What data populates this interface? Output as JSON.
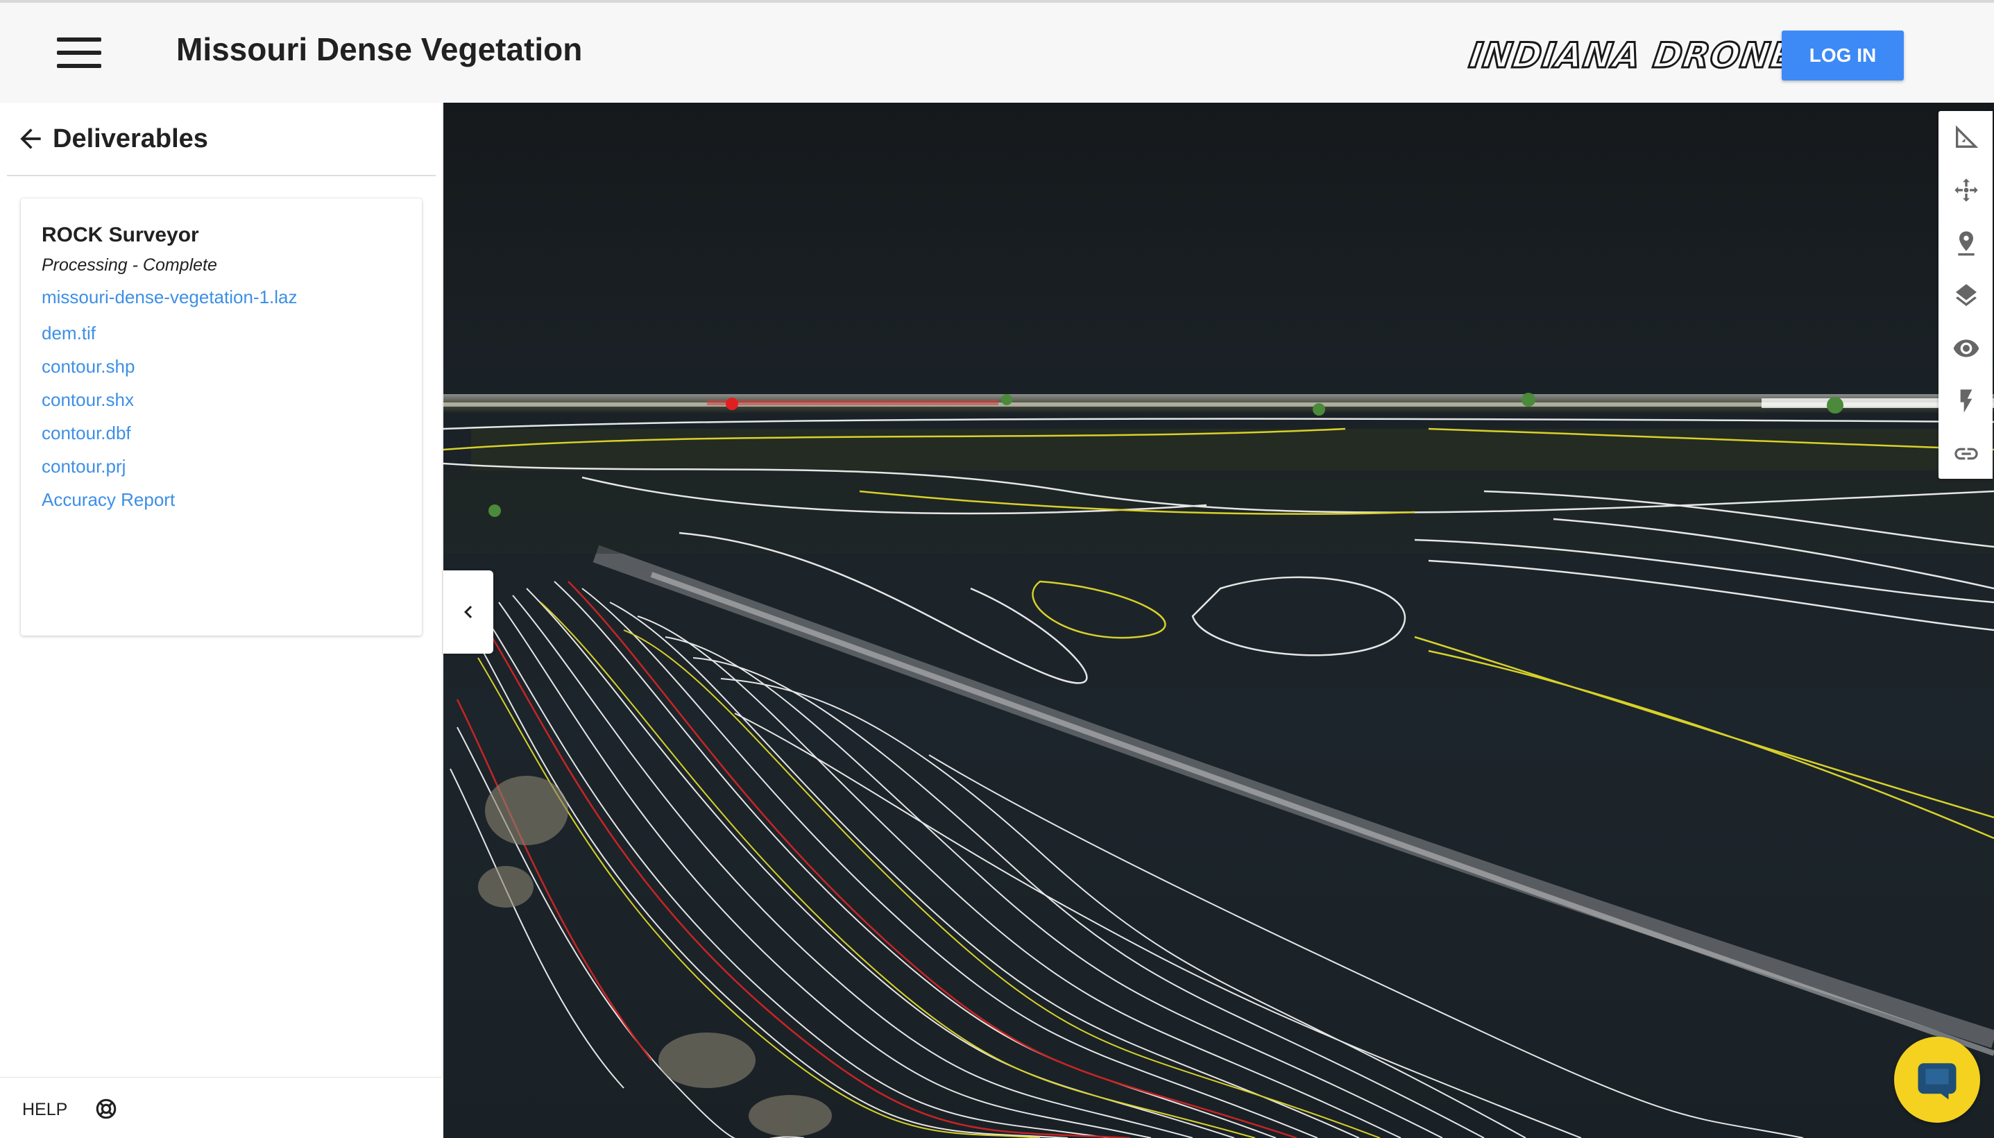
{
  "header": {
    "title": "Missouri Dense Vegetation",
    "brand": "INDIANA DRONES",
    "login_label": "LOG IN"
  },
  "sidebar": {
    "heading": "Deliverables",
    "card": {
      "title": "ROCK Surveyor",
      "status": "Processing - Complete",
      "links": [
        "missouri-dense-vegetation-1.laz",
        "dem.tif",
        "contour.shp",
        "contour.shx",
        "contour.dbf",
        "contour.prj",
        "Accuracy Report"
      ]
    },
    "footer": {
      "help_label": "HELP"
    }
  },
  "viewer": {
    "tools": [
      "measure-icon",
      "move-icon",
      "location-pin-icon",
      "layers-icon",
      "eye-icon",
      "flash-icon",
      "link-icon"
    ]
  },
  "colors": {
    "accent": "#3d8af7",
    "link": "#3d8fe6",
    "contour_white": "#e6e6e6",
    "contour_yellow": "#d8d12a",
    "contour_red": "#c82424",
    "chat": "#f5d21f"
  }
}
